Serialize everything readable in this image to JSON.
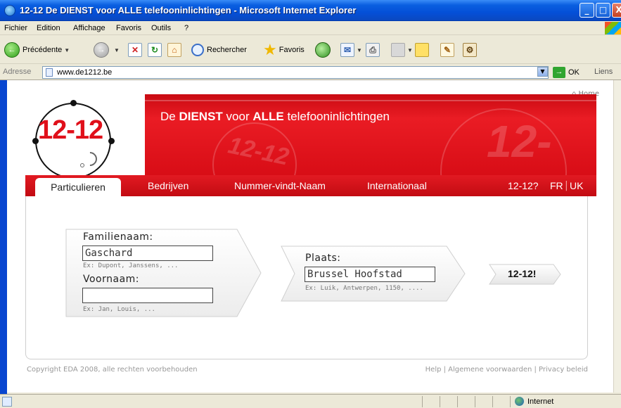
{
  "window": {
    "title": "12-12 De DIENST voor ALLE telefooninlichtingen - Microsoft Internet Explorer",
    "minimize": "_",
    "maximize": "□",
    "close": "X"
  },
  "menu": {
    "items": [
      "Fichier",
      "Edition",
      "Affichage",
      "Favoris",
      "Outils",
      "?"
    ]
  },
  "toolbar": {
    "back_label": "Précédente",
    "search_label": "Rechercher",
    "favorites_label": "Favoris"
  },
  "address": {
    "label": "Adresse",
    "url": "www.de1212.be",
    "go_label": "OK",
    "links_label": "Liens"
  },
  "site": {
    "home_link": "Home",
    "logo_text": "12-12",
    "tagline_prefix": "De ",
    "tagline_b1": "DIENST",
    "tagline_mid": " voor ",
    "tagline_b2": "ALLE",
    "tagline_suffix": " telefooninlichtingen",
    "banner_watermark": "12-12"
  },
  "nav": {
    "active_tab": "Particulieren",
    "items": [
      "Bedrijven",
      "Nummer-vindt-Naam",
      "Internationaal",
      "12-12?"
    ],
    "lang_fr": "FR",
    "lang_sep": "|",
    "lang_uk": "UK"
  },
  "form": {
    "lastname_label": "Familienaam:",
    "lastname_value": "Gaschard",
    "lastname_hint": "Ex: Dupont, Janssens, ...",
    "firstname_label": "Voornaam:",
    "firstname_value": "",
    "firstname_hint": "Ex: Jan, Louis, ...",
    "place_label": "Plaats:",
    "place_value": "Brussel Hoofstad",
    "place_hint": "Ex: Luik, Antwerpen, 1150, ....",
    "submit_label": "12-12!"
  },
  "footer": {
    "copyright": "Copyright EDA 2008, alle rechten voorbehouden",
    "links": "Help | Algemene voorwaarden | Privacy beleid"
  },
  "status": {
    "zone": "Internet"
  },
  "colors": {
    "brand_red": "#e0101a",
    "xp_blue": "#0a5fe0"
  }
}
